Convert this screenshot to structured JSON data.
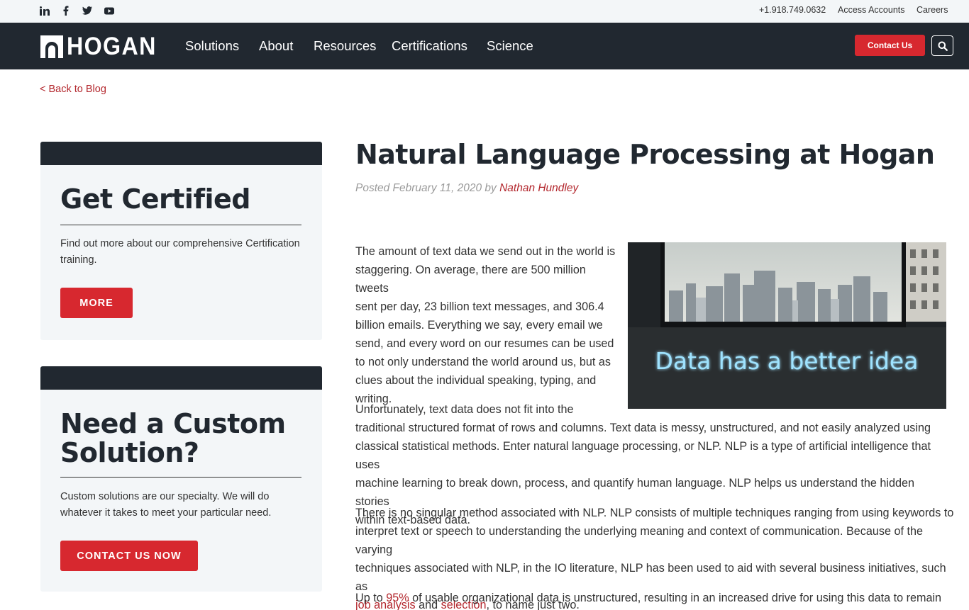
{
  "topbar": {
    "social": [
      "linkedin-icon",
      "facebook-icon",
      "twitter-icon",
      "youtube-icon"
    ],
    "phone": "+1.918.749.0632",
    "access_accounts": "Access Accounts",
    "careers": "Careers"
  },
  "nav": {
    "logo": "HOGAN",
    "items": [
      "Solutions",
      "About",
      "Resources",
      "Certifications",
      "Science"
    ],
    "contact_label": "Contact Us",
    "search_icon": "search-icon"
  },
  "back_link": "< Back to Blog",
  "sidebar": {
    "card1": {
      "title": "Get Certified",
      "desc": "Find out more about our comprehensive Certification training.",
      "button": "MORE"
    },
    "card2": {
      "title_line1": "Need a Custom",
      "title_line2": "Solution?",
      "desc": "Custom solutions are our specialty. We will do whatever it takes to meet your particular need.",
      "button": "CONTACT US NOW"
    }
  },
  "article": {
    "title": "Natural Language Processing at Hogan",
    "posted": "Posted February 11, 2020 by",
    "author": "Nathan Hundley",
    "p1_lines": [
      "The amount of text data we send out in the world is",
      "staggering. On average, there are 500 million tweets",
      "sent per day, 23 billion text messages, and 306.4",
      "billion emails. Everything we say, every email we",
      "send, and every word on our resumes can be used",
      "to not only understand the world around us, but as",
      "clues about the individual speaking, typing, and",
      "writing."
    ],
    "p2_lines": [
      "Unfortunately, text data does not fit into the",
      "traditional structured format of rows and columns. Text data is messy, unstructured, and not easily analyzed using",
      "classical statistical methods. Enter natural language processing, or NLP. NLP is a type of artificial intelligence that uses",
      "machine learning to break down, process, and quantify human language. NLP helps us understand the hidden stories",
      "within text-based data."
    ],
    "p3_lines": [
      "There is no singular method associated with NLP. NLP consists of multiple techniques ranging from using keywords to",
      "interpret text or speech to understanding the underlying meaning and context of communication. Because of the varying",
      "techniques associated with NLP, in the IO literature, NLP has been used to aid with several business initiatives, such as"
    ],
    "p3_link1": "job analysis",
    "p3_and": "and",
    "p3_link2": "selection",
    "p3_end": ", to name just two.",
    "p4_start": "Up to",
    "p4_link": "95%",
    "p4_rest": "of usable organizational data is unstructured, resulting in an increased drive for using this data to remain",
    "image_neon_text": "Data has a better idea"
  }
}
